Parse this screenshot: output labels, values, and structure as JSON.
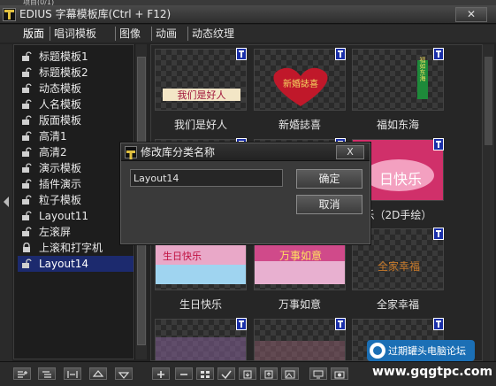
{
  "window": {
    "top_tab_stub": "项目(0/1)",
    "title": "EDIUS 字幕模板库(Ctrl + F12)",
    "close_label": "✕"
  },
  "tabs": [
    {
      "label": "版面",
      "active": true
    },
    {
      "label": "唱词模板",
      "active": false
    },
    {
      "label": "图像",
      "active": false
    },
    {
      "label": "动画",
      "active": false
    },
    {
      "label": "动态纹理",
      "active": false
    }
  ],
  "categories": [
    {
      "label": "标题模板1",
      "locked": false,
      "selected": false
    },
    {
      "label": "标题模板2",
      "locked": false,
      "selected": false
    },
    {
      "label": "动态模板",
      "locked": false,
      "selected": false
    },
    {
      "label": "人名模板",
      "locked": false,
      "selected": false
    },
    {
      "label": "版面模板",
      "locked": false,
      "selected": false
    },
    {
      "label": "高清1",
      "locked": false,
      "selected": false
    },
    {
      "label": "高清2",
      "locked": false,
      "selected": false
    },
    {
      "label": "演示模板",
      "locked": false,
      "selected": false
    },
    {
      "label": "插件演示",
      "locked": false,
      "selected": false
    },
    {
      "label": "粒子模板",
      "locked": false,
      "selected": false
    },
    {
      "label": "Layout11",
      "locked": false,
      "selected": false
    },
    {
      "label": "左滚屏",
      "locked": false,
      "selected": false
    },
    {
      "label": "上滚和打字机",
      "locked": true,
      "selected": false
    },
    {
      "label": "Layout14",
      "locked": false,
      "selected": true
    }
  ],
  "templates": [
    {
      "caption": "我们是好人",
      "art_text": "我们是好人",
      "icon": "template-file-icon"
    },
    {
      "caption": "新婚誌喜",
      "art_text": "新婚誌喜",
      "icon": "template-file-icon"
    },
    {
      "caption": "福如东海",
      "art_text": "福如东海",
      "icon": "template-file-icon"
    },
    {
      "caption": "",
      "art_text": "",
      "icon": "template-file-icon"
    },
    {
      "caption": "",
      "art_text": "",
      "icon": "template-file-icon"
    },
    {
      "caption": "乐（2D手绘）",
      "art_text": "日快乐",
      "icon": "template-file-icon"
    },
    {
      "caption": "生日快乐",
      "art_text": "生日快乐",
      "icon": "template-file-icon"
    },
    {
      "caption": "万事如意",
      "art_text": "万事如意",
      "icon": "template-file-icon"
    },
    {
      "caption": "全家幸福",
      "art_text": "全家幸福",
      "icon": "template-file-icon"
    },
    {
      "caption": "",
      "art_text": "",
      "icon": "template-file-icon"
    },
    {
      "caption": "",
      "art_text": "",
      "icon": "template-file-icon"
    },
    {
      "caption": "",
      "art_text": "",
      "icon": "template-file-icon"
    }
  ],
  "dialog": {
    "title": "修改库分类名称",
    "close_label": "X",
    "input_value": "Layout14",
    "ok_label": "确定",
    "cancel_label": "取消"
  },
  "left_toolbar_icons": [
    "add-category-icon",
    "add-subcategory-icon",
    "expand-icon",
    "move-up-icon",
    "move-down-icon"
  ],
  "right_toolbar_icons": [
    "add-template-icon",
    "remove-template-icon",
    "grid-icon",
    "check-icon",
    "import-icon",
    "export-icon",
    "image-icon",
    "monitor-icon",
    "camera-icon"
  ],
  "watermark": {
    "line1": "过期罐头电脑论坛",
    "line2": "www.gqgtpc.com"
  },
  "colors": {
    "selected_row": "#1c2a6e",
    "panel_bg": "#1d1d1d",
    "heart_red": "#c0182a"
  }
}
